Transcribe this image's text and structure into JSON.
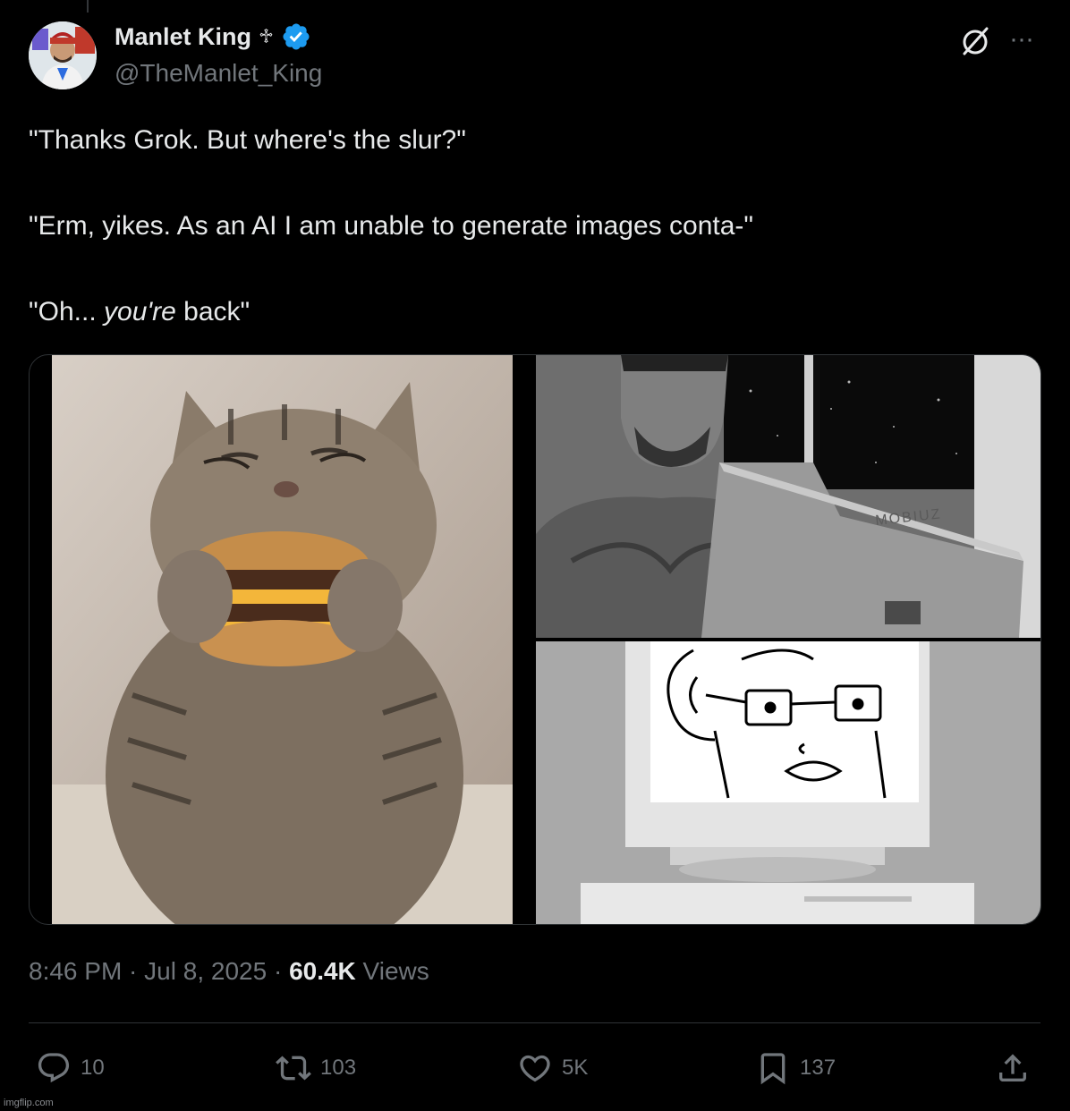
{
  "author": {
    "display_name": "Manlet King",
    "name_symbol": "♱",
    "handle": "@TheManlet_King",
    "verified": true,
    "verified_color": "#1d9bf0"
  },
  "tweet": {
    "line1": "\"Thanks Grok. But where's the slur?\"",
    "line2": "\"Erm, yikes. As an AI I am unable to generate images conta-\"",
    "line3_prefix": "\"Oh... ",
    "line3_italic": "you're",
    "line3_suffix": " back\""
  },
  "meta": {
    "time": "8:46 PM",
    "separator": " · ",
    "date": "Jul 8, 2025",
    "views_count": "60.4K",
    "views_label": " Views"
  },
  "actions": {
    "replies": "10",
    "reposts": "103",
    "likes": "5K",
    "bookmarks": "137"
  },
  "icons": {
    "header": [
      "grok-icon",
      "more-icon"
    ],
    "actions": [
      "reply-icon",
      "retweet-icon",
      "like-icon",
      "bookmark-icon",
      "share-icon"
    ]
  },
  "monitor_brand": "MOBIUZ",
  "watermark": "imgflip.com",
  "colors": {
    "background": "#000000",
    "text": "#e7e9ea",
    "muted": "#71767b",
    "border": "#2f3336"
  }
}
